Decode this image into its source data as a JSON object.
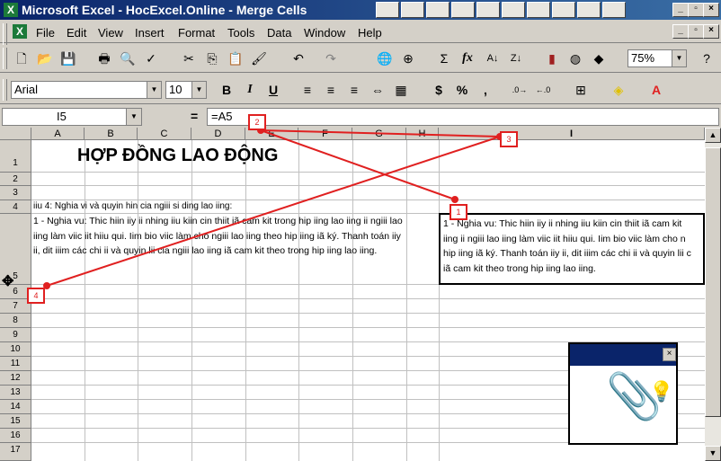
{
  "window": {
    "title": "Microsoft Excel - HocExcel.Online - Merge Cells"
  },
  "menu": [
    "File",
    "Edit",
    "View",
    "Insert",
    "Format",
    "Tools",
    "Data",
    "Window",
    "Help"
  ],
  "toolbar": {
    "zoom": "75%",
    "undo_icon": "undo-icon",
    "sum_symbol": "Σ",
    "fx_symbol": "fx"
  },
  "format_bar": {
    "font": "Arial",
    "size": "10",
    "bold": "B",
    "italic": "I",
    "underline": "U",
    "currency": "$",
    "percent": "%",
    "comma": ","
  },
  "formula_bar": {
    "name_box": "I5",
    "formula": "=A5",
    "equals": "="
  },
  "columns": [
    "A",
    "B",
    "C",
    "D",
    "E",
    "F",
    "G",
    "H",
    "I"
  ],
  "rows": [
    "1",
    "2",
    "3",
    "4",
    "5",
    "6",
    "7",
    "8",
    "9",
    "10",
    "11",
    "12",
    "13",
    "14",
    "15",
    "16",
    "17"
  ],
  "cells": {
    "title": "HỢP ĐỒNG LAO ĐỘNG",
    "A4": "iiu 4: Nghia vi và quyin hin cia ngiii si ding lao iing:",
    "A5": "1 - Nghia vu: Thic hiin iiy ii nhing iiu kiin cin thiit iã cam kit trong hip iing lao iing ii ngiii lao iing làm viic iit hiiu qui. Iim bio viic làm cho ngiii lao iing theo hip iing iã ký. Thanh toán iiy ii, dit iiim các chi ii và quyin lii cia ngiii lao iing iã cam kit theo trong hip iing lao iing.",
    "I5_lines": [
      "1 - Nghia vu: Thic hiin iiy ii nhing iiu kiin cin thiit iã cam kit",
      "iing ii ngiii lao iing làm viic iit hiiu qui. Iim bio viic làm cho n",
      "hip iing iã ký. Thanh toán iiy ii, dit iiim các chi ii và quyin lii c",
      "iã cam kit theo trong hip iing lao iing."
    ]
  },
  "annotations": [
    "1",
    "2",
    "3",
    "4"
  ],
  "colors": {
    "title_bar": "#0a246a",
    "callout": "#e02020",
    "face": "#d4d0c8"
  }
}
